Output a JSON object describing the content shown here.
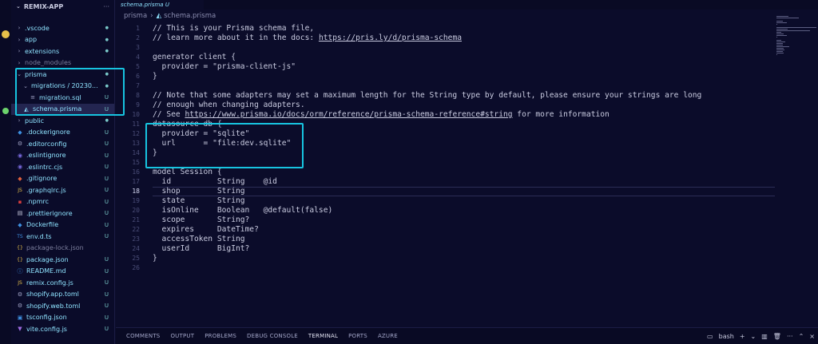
{
  "sidebar": {
    "title": "REMIX-APP",
    "more": "···",
    "items": [
      {
        "label": ".vscode",
        "icon": "chevron",
        "badge": "●",
        "color": "#8fe3ff",
        "folder": true
      },
      {
        "label": "app",
        "icon": "chevron",
        "badge": "●",
        "color": "#8fe3ff",
        "folder": true
      },
      {
        "label": "extensions",
        "icon": "chevron",
        "badge": "●",
        "color": "#8fe3ff",
        "folder": true
      },
      {
        "label": "node_modules",
        "icon": "chevron",
        "badge": "",
        "color": "#7b7e9c",
        "folder": true
      },
      {
        "label": "prisma",
        "icon": "chevron-down",
        "badge": "●",
        "color": "#8fe3ff",
        "folder": true
      },
      {
        "label": "migrations / 20230...",
        "icon": "chevron-down",
        "badge": "●",
        "color": "#8fe3ff",
        "folder": true
      },
      {
        "label": "migration.sql",
        "icon": "file",
        "badge": "U",
        "color": "#8fe3ff",
        "folder": false
      },
      {
        "label": "schema.prisma",
        "icon": "prisma",
        "badge": "U",
        "color": "#8fe3ff",
        "folder": false
      },
      {
        "label": "public",
        "icon": "chevron",
        "badge": "●",
        "color": "#8fe3ff",
        "folder": true
      },
      {
        "label": ".dockerignore",
        "icon": "docker",
        "badge": "U",
        "color": "#8fe3ff",
        "folder": false
      },
      {
        "label": ".editorconfig",
        "icon": "gear",
        "badge": "U",
        "color": "#8fe3ff",
        "folder": false
      },
      {
        "label": ".eslintignore",
        "icon": "eslint",
        "badge": "U",
        "color": "#8fe3ff",
        "folder": false
      },
      {
        "label": ".eslintrc.cjs",
        "icon": "eslint",
        "badge": "U",
        "color": "#8fe3ff",
        "folder": false
      },
      {
        "label": ".gitignore",
        "icon": "git",
        "badge": "U",
        "color": "#8fe3ff",
        "folder": false
      },
      {
        "label": ".graphqlrc.js",
        "icon": "js",
        "badge": "U",
        "color": "#8fe3ff",
        "folder": false
      },
      {
        "label": ".npmrc",
        "icon": "npm",
        "badge": "U",
        "color": "#8fe3ff",
        "folder": false
      },
      {
        "label": ".prettierignore",
        "icon": "prettier",
        "badge": "U",
        "color": "#8fe3ff",
        "folder": false
      },
      {
        "label": "Dockerfile",
        "icon": "docker",
        "badge": "U",
        "color": "#8fe3ff",
        "folder": false
      },
      {
        "label": "env.d.ts",
        "icon": "ts",
        "badge": "U",
        "color": "#8fe3ff",
        "folder": false
      },
      {
        "label": "package-lock.json",
        "icon": "json",
        "badge": "",
        "color": "#7b7e9c",
        "folder": false
      },
      {
        "label": "package.json",
        "icon": "json",
        "badge": "U",
        "color": "#8fe3ff",
        "folder": false
      },
      {
        "label": "README.md",
        "icon": "info",
        "badge": "U",
        "color": "#8fe3ff",
        "folder": false
      },
      {
        "label": "remix.config.js",
        "icon": "js",
        "badge": "U",
        "color": "#8fe3ff",
        "folder": false
      },
      {
        "label": "shopify.app.toml",
        "icon": "gear",
        "badge": "U",
        "color": "#8fe3ff",
        "folder": false
      },
      {
        "label": "shopify.web.toml",
        "icon": "gear",
        "badge": "U",
        "color": "#8fe3ff",
        "folder": false
      },
      {
        "label": "tsconfig.json",
        "icon": "tsconfig",
        "badge": "U",
        "color": "#8fe3ff",
        "folder": false
      },
      {
        "label": "vite.config.js",
        "icon": "vite",
        "badge": "U",
        "color": "#8fe3ff",
        "folder": false
      }
    ]
  },
  "tab": {
    "label": "schema.prisma U"
  },
  "breadcrumb": {
    "folder": "prisma",
    "file": "schema.prisma"
  },
  "editor": {
    "active_line": 18,
    "lines": [
      "// This is your Prisma schema file,",
      "// learn more about it in the docs: https://pris.ly/d/prisma-schema",
      "",
      "generator client {",
      "  provider = \"prisma-client-js\"",
      "}",
      "",
      "// Note that some adapters may set a maximum length for the String type by default, please ensure your strings are long",
      "// enough when changing adapters.",
      "// See https://www.prisma.io/docs/orm/reference/prisma-schema-reference#string for more information",
      "datasource db {",
      "  provider = \"sqlite\"",
      "  url      = \"file:dev.sqlite\"",
      "}",
      "",
      "model Session {",
      "  id          String    @id",
      "  shop        String",
      "  state       String",
      "  isOnline    Boolean   @default(false)",
      "  scope       String?",
      "  expires     DateTime?",
      "  accessToken String",
      "  userId      BigInt?",
      "}",
      ""
    ]
  },
  "panel": {
    "tabs": [
      "COMMENTS",
      "OUTPUT",
      "PROBLEMS",
      "DEBUG CONSOLE",
      "TERMINAL",
      "PORTS",
      "AZURE"
    ],
    "active_tab": "TERMINAL",
    "terminal_name": "bash",
    "icons": [
      "terminal-icon",
      "plus-icon",
      "chevron-down-icon",
      "split-icon",
      "trash-icon",
      "more-icon",
      "chevron-up-icon",
      "close-icon"
    ]
  },
  "colors": {
    "background": "#0b0c2a",
    "highlight": "#17c4e0",
    "file_text": "#8fe3ff"
  }
}
